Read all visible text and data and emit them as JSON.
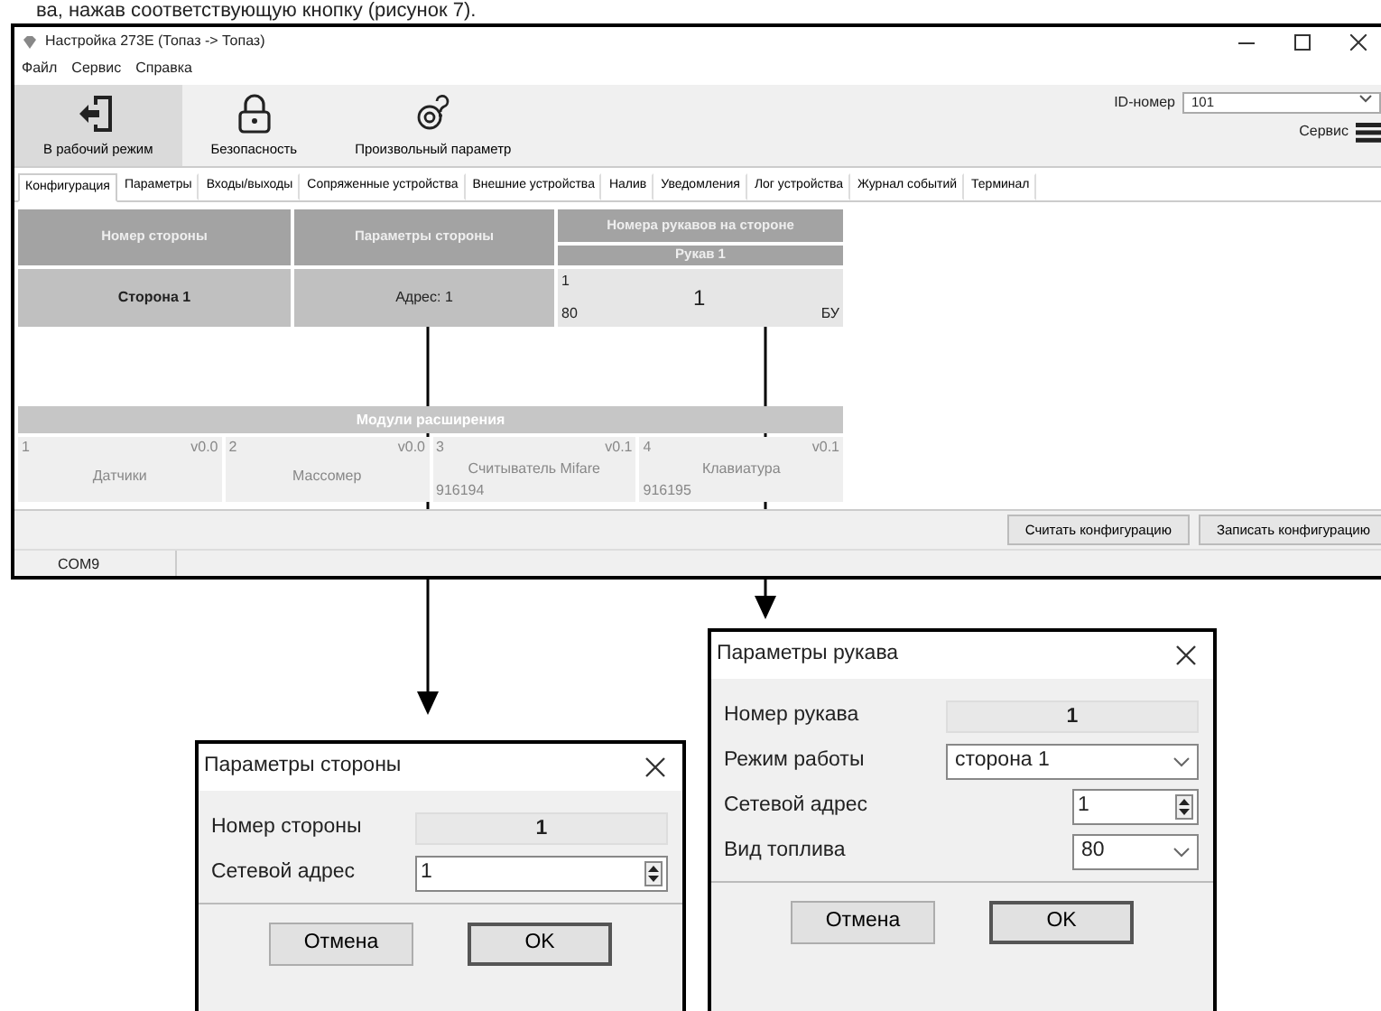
{
  "caption_fragment": "ва, нажав соответствующую кнопку (рисунок 7).",
  "main_window": {
    "title": "Настройка 273E (Топаз -> Топаз)",
    "menu": [
      "Файл",
      "Сервис",
      "Справка"
    ],
    "toolbar": [
      {
        "label": "В рабочий режим",
        "kind": "exit",
        "selected": true
      },
      {
        "label": "Безопасность",
        "kind": "lock",
        "selected": false
      },
      {
        "label": "Произвольный параметр",
        "kind": "custom",
        "selected": false
      }
    ],
    "id_field": {
      "label": "ID-номер",
      "value": "101"
    },
    "service": {
      "label": "Сервис"
    },
    "tabs": [
      {
        "label": "Конфигурация",
        "selected": true
      },
      {
        "label": "Параметры",
        "selected": false
      },
      {
        "label": "Входы/выходы",
        "selected": false
      },
      {
        "label": "Сопряженные устройства",
        "selected": false
      },
      {
        "label": "Внешние устройства",
        "selected": false
      },
      {
        "label": "Налив",
        "selected": false
      },
      {
        "label": "Уведомления",
        "selected": false
      },
      {
        "label": "Лог устройства",
        "selected": false
      },
      {
        "label": "Журнал событий",
        "selected": false
      },
      {
        "label": "Терминал",
        "selected": false
      }
    ],
    "config_table": {
      "columns": [
        "Номер стороны",
        "Параметры стороны"
      ],
      "hose_group": "Номера рукавов на стороне",
      "hose_columns": [
        "Рукав 1"
      ],
      "rows": [
        {
          "side": "Сторона 1",
          "params": "Адрес: 1",
          "hoses": [
            {
              "address": "1",
              "fuel": "80",
              "number": "1",
              "mode": "БУ"
            }
          ]
        }
      ]
    },
    "modules": {
      "title": "Модули расширения",
      "items": [
        {
          "slot": "1",
          "version": "v0.0",
          "name": "Датчики"
        },
        {
          "slot": "2",
          "version": "v0.0",
          "name": "Массомер"
        },
        {
          "slot": "3",
          "version": "v0.1",
          "name": "Считыватель Mifare",
          "serial": "916194"
        },
        {
          "slot": "4",
          "version": "v0.1",
          "name": "Клавиатура",
          "serial": "916195"
        }
      ]
    },
    "buttons": [
      "Считать конфигурацию",
      "Записать конфигурацию"
    ],
    "status_bar": [
      "COM9"
    ]
  },
  "side_dialog": {
    "title": "Параметры стороны",
    "fields": [
      {
        "label": "Номер стороны",
        "kind": "readonly",
        "value": "1"
      },
      {
        "label": "Сетевой адрес",
        "kind": "spin",
        "value": "1"
      }
    ],
    "buttons": [
      {
        "label": "Отмена",
        "default": false
      },
      {
        "label": "OK",
        "default": true
      }
    ]
  },
  "hose_dialog": {
    "title": "Параметры рукава",
    "fields": [
      {
        "label": "Номер рукава",
        "kind": "readonly",
        "value": "1"
      },
      {
        "label": "Режим работы",
        "kind": "combo",
        "value": "сторона 1"
      },
      {
        "label": "Сетевой адрес",
        "kind": "spin",
        "value": "1"
      },
      {
        "label": "Вид топлива",
        "kind": "combo",
        "value": "80"
      }
    ],
    "buttons": [
      {
        "label": "Отмена",
        "default": false
      },
      {
        "label": "OK",
        "default": true
      }
    ]
  }
}
